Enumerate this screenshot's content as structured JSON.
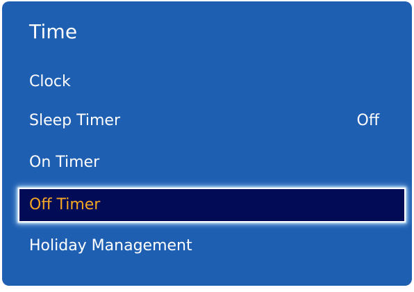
{
  "menu": {
    "title": "Time",
    "items": [
      {
        "label": "Clock",
        "value": ""
      },
      {
        "label": "Sleep Timer",
        "value": "Off"
      },
      {
        "label": "On Timer",
        "value": ""
      },
      {
        "label": "Off Timer",
        "value": "",
        "selected": true
      },
      {
        "label": "Holiday Management",
        "value": ""
      }
    ]
  },
  "colors": {
    "panel_background": "#1f5fb2",
    "selected_background": "#020b55",
    "selected_text": "#f5a623",
    "text": "#ffffff"
  }
}
